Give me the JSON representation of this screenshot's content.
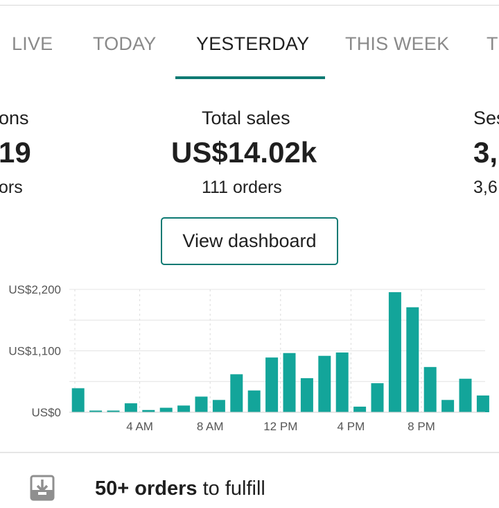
{
  "tabs": [
    {
      "label": "LIVE",
      "active": false
    },
    {
      "label": "TODAY",
      "active": false
    },
    {
      "label": "YESTERDAY",
      "active": true
    },
    {
      "label": "THIS WEEK",
      "active": false
    },
    {
      "label": "T",
      "active": false
    }
  ],
  "stats": [
    {
      "label": "ons",
      "value": "19",
      "sub": "ors"
    },
    {
      "label": "Total sales",
      "value": "US$14.02k",
      "sub": "111 orders"
    },
    {
      "label": "Ses",
      "value": "3,",
      "sub": "3,6"
    }
  ],
  "dashboard_button": "View dashboard",
  "colors": {
    "accent": "#0d7a73",
    "bar": "#13a59a"
  },
  "chart_data": {
    "type": "bar",
    "y_tick_labels": [
      "US$0",
      "US$1,100",
      "US$2,200"
    ],
    "y_ticks": [
      0,
      1100,
      2200
    ],
    "ylim": [
      0,
      2200
    ],
    "x_tick_labels": [
      "4 AM",
      "8 AM",
      "12 PM",
      "4 PM",
      "8 PM"
    ],
    "x_tick_hours": [
      4,
      8,
      12,
      16,
      20
    ],
    "hours": [
      0,
      1,
      2,
      3,
      4,
      5,
      6,
      7,
      8,
      9,
      10,
      11,
      12,
      13,
      14,
      15,
      16,
      17,
      18,
      19,
      20,
      21,
      22,
      23
    ],
    "values": [
      430,
      30,
      30,
      160,
      40,
      80,
      120,
      280,
      220,
      680,
      390,
      980,
      1060,
      610,
      1010,
      1070,
      100,
      520,
      2150,
      1880,
      810,
      220,
      600,
      300
    ]
  },
  "fulfill": {
    "icon": "download-tray-icon",
    "bold": "50+ orders",
    "rest": " to fulfill"
  }
}
